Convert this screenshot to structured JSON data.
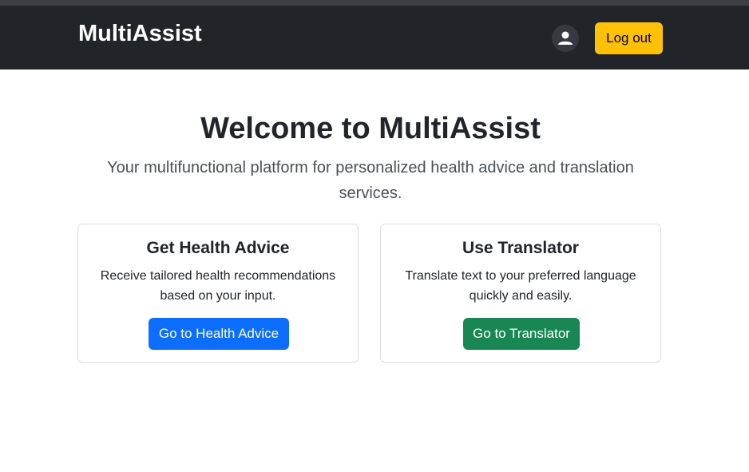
{
  "navbar": {
    "brand": "MultiAssist",
    "user_icon": "user-icon",
    "logout_label": "Log out"
  },
  "hero": {
    "title": "Welcome to MultiAssist",
    "subtitle": "Your multifunctional platform for personalized health advice and translation services."
  },
  "cards": [
    {
      "title": "Get Health Advice",
      "text": "Receive tailored health recommendations based on your input.",
      "button_label": "Go to Health Advice",
      "button_color": "#0d6efd"
    },
    {
      "title": "Use Translator",
      "text": "Translate text to your preferred language quickly and easily.",
      "button_label": "Go to Translator",
      "button_color": "#198754"
    }
  ],
  "colors": {
    "navbar_bg": "#212529",
    "logout_bg": "#ffc107"
  }
}
